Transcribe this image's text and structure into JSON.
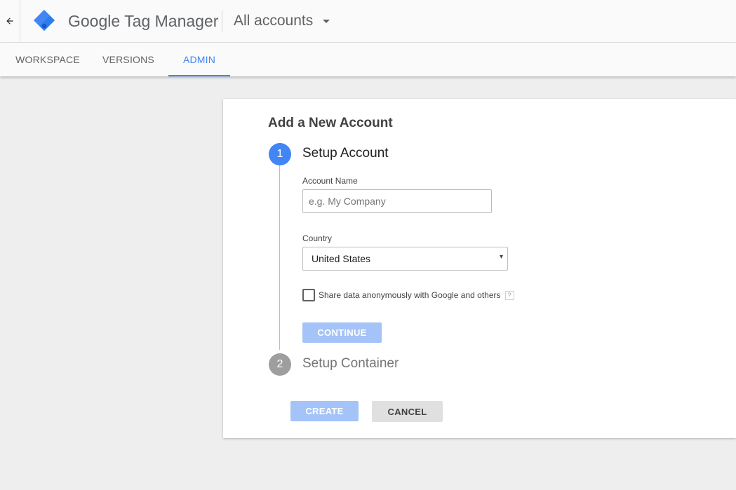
{
  "header": {
    "back_icon": "arrow-left-icon",
    "logo_icon": "tag-manager-logo-icon",
    "product_brand": "Google",
    "product_name": "Tag Manager",
    "account_selector": "All accounts",
    "account_caret_icon": "caret-down-icon"
  },
  "tabs": [
    {
      "label": "WORKSPACE",
      "active": false
    },
    {
      "label": "VERSIONS",
      "active": false
    },
    {
      "label": "ADMIN",
      "active": true
    }
  ],
  "card": {
    "title": "Add a New Account",
    "steps": [
      {
        "number": "1",
        "title": "Setup Account",
        "active": true
      },
      {
        "number": "2",
        "title": "Setup Container",
        "active": false
      }
    ],
    "account_name": {
      "label": "Account Name",
      "placeholder": "e.g. My Company",
      "value": ""
    },
    "country": {
      "label": "Country",
      "selected": "United States",
      "arrow": "▾"
    },
    "share_data": {
      "label": "Share data anonymously with Google and others",
      "checked": false,
      "help": "?"
    },
    "buttons": {
      "continue": "CONTINUE",
      "create": "CREATE",
      "cancel": "CANCEL"
    }
  },
  "colors": {
    "accent": "#4285f4",
    "disabled_button": "#a4c3f8",
    "background": "#eeeeee",
    "step_inactive": "#9e9e9e"
  }
}
